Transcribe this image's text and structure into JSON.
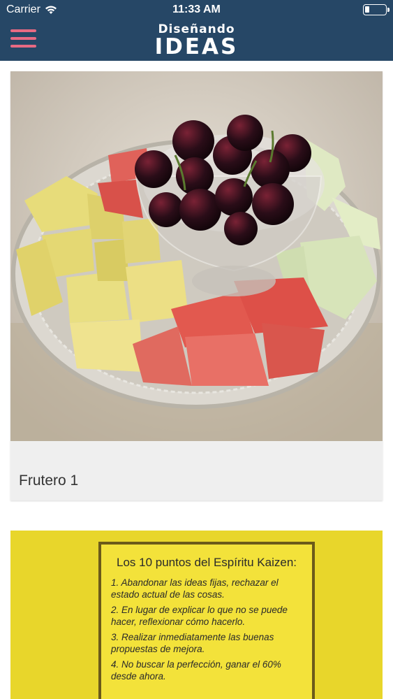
{
  "status_bar": {
    "carrier": "Carrier",
    "time": "11:33 AM"
  },
  "header": {
    "logo_line1": "Diseñando",
    "logo_line2": "IDEAS",
    "accent_color": "#e86a83",
    "background_color": "#264766"
  },
  "feed": [
    {
      "title": "Frutero 1",
      "image": "fruit-platter-photo"
    },
    {
      "image": "kaizen-sign-photo",
      "sign_title": "Los 10 puntos del Espíritu Kaizen:",
      "points": [
        "1. Abandonar las ideas fijas, rechazar el estado actual de las cosas.",
        "2. En lugar de explicar lo que no se puede hacer, reflexionar cómo hacerlo.",
        "3. Realizar inmediatamente las buenas propuestas de mejora.",
        "4. No buscar la perfección, ganar el 60% desde ahora."
      ]
    }
  ]
}
